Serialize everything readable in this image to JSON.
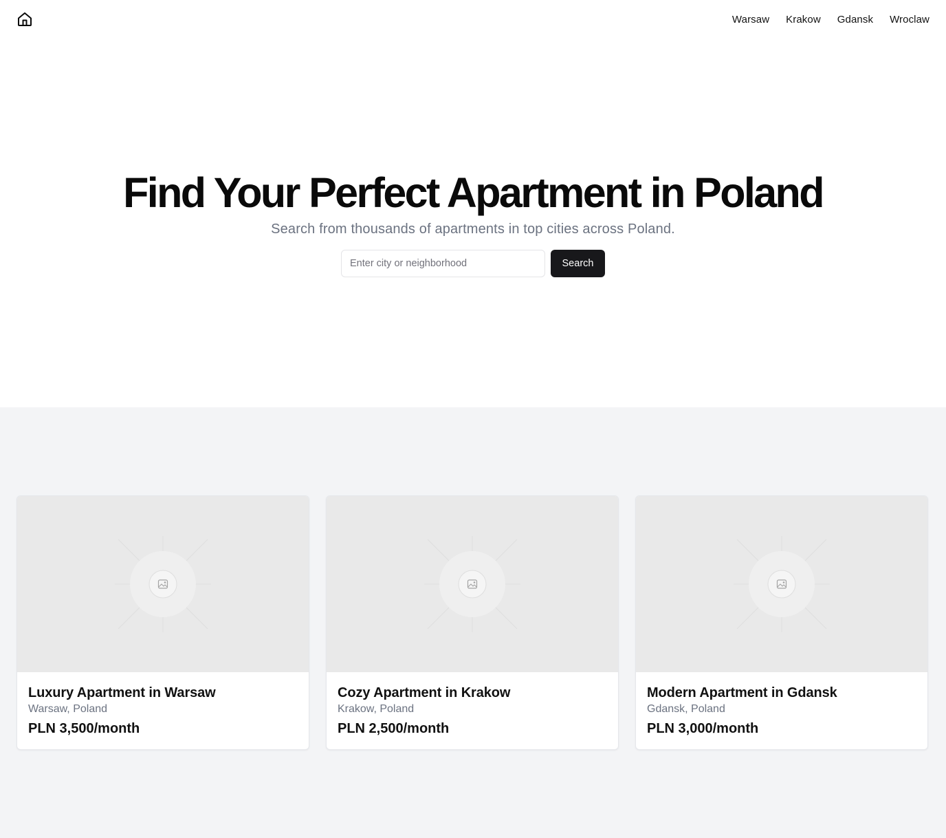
{
  "header": {
    "logo_icon": "home-icon",
    "nav": [
      {
        "label": "Warsaw"
      },
      {
        "label": "Krakow"
      },
      {
        "label": "Gdansk"
      },
      {
        "label": "Wroclaw"
      }
    ]
  },
  "hero": {
    "title": "Find Your Perfect Apartment in Poland",
    "subtitle": "Search from thousands of apartments in top cities across Poland.",
    "search": {
      "placeholder": "Enter city or neighborhood",
      "value": "",
      "button_label": "Search"
    }
  },
  "listings": [
    {
      "title": "Luxury Apartment in Warsaw",
      "location": "Warsaw, Poland",
      "price": "PLN 3,500/month",
      "image_icon": "image-placeholder-icon"
    },
    {
      "title": "Cozy Apartment in Krakow",
      "location": "Krakow, Poland",
      "price": "PLN 2,500/month",
      "image_icon": "image-placeholder-icon"
    },
    {
      "title": "Modern Apartment in Gdansk",
      "location": "Gdansk, Poland",
      "price": "PLN 3,000/month",
      "image_icon": "image-placeholder-icon"
    }
  ],
  "colors": {
    "accent": "#18181b",
    "muted_text": "#6b7280",
    "section_background": "#f3f4f6",
    "image_placeholder": "#e9e9e9"
  }
}
